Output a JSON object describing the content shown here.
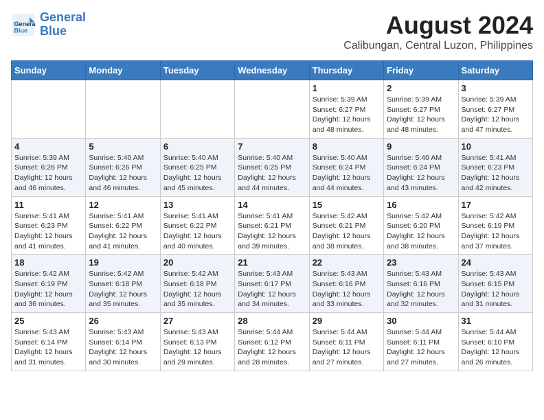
{
  "header": {
    "logo_line1": "General",
    "logo_line2": "Blue",
    "month_year": "August 2024",
    "location": "Calibungan, Central Luzon, Philippines"
  },
  "weekdays": [
    "Sunday",
    "Monday",
    "Tuesday",
    "Wednesday",
    "Thursday",
    "Friday",
    "Saturday"
  ],
  "weeks": [
    [
      {
        "day": "",
        "info": ""
      },
      {
        "day": "",
        "info": ""
      },
      {
        "day": "",
        "info": ""
      },
      {
        "day": "",
        "info": ""
      },
      {
        "day": "1",
        "info": "Sunrise: 5:39 AM\nSunset: 6:27 PM\nDaylight: 12 hours\nand 48 minutes."
      },
      {
        "day": "2",
        "info": "Sunrise: 5:39 AM\nSunset: 6:27 PM\nDaylight: 12 hours\nand 48 minutes."
      },
      {
        "day": "3",
        "info": "Sunrise: 5:39 AM\nSunset: 6:27 PM\nDaylight: 12 hours\nand 47 minutes."
      }
    ],
    [
      {
        "day": "4",
        "info": "Sunrise: 5:39 AM\nSunset: 6:26 PM\nDaylight: 12 hours\nand 46 minutes."
      },
      {
        "day": "5",
        "info": "Sunrise: 5:40 AM\nSunset: 6:26 PM\nDaylight: 12 hours\nand 46 minutes."
      },
      {
        "day": "6",
        "info": "Sunrise: 5:40 AM\nSunset: 6:25 PM\nDaylight: 12 hours\nand 45 minutes."
      },
      {
        "day": "7",
        "info": "Sunrise: 5:40 AM\nSunset: 6:25 PM\nDaylight: 12 hours\nand 44 minutes."
      },
      {
        "day": "8",
        "info": "Sunrise: 5:40 AM\nSunset: 6:24 PM\nDaylight: 12 hours\nand 44 minutes."
      },
      {
        "day": "9",
        "info": "Sunrise: 5:40 AM\nSunset: 6:24 PM\nDaylight: 12 hours\nand 43 minutes."
      },
      {
        "day": "10",
        "info": "Sunrise: 5:41 AM\nSunset: 6:23 PM\nDaylight: 12 hours\nand 42 minutes."
      }
    ],
    [
      {
        "day": "11",
        "info": "Sunrise: 5:41 AM\nSunset: 6:23 PM\nDaylight: 12 hours\nand 41 minutes."
      },
      {
        "day": "12",
        "info": "Sunrise: 5:41 AM\nSunset: 6:22 PM\nDaylight: 12 hours\nand 41 minutes."
      },
      {
        "day": "13",
        "info": "Sunrise: 5:41 AM\nSunset: 6:22 PM\nDaylight: 12 hours\nand 40 minutes."
      },
      {
        "day": "14",
        "info": "Sunrise: 5:41 AM\nSunset: 6:21 PM\nDaylight: 12 hours\nand 39 minutes."
      },
      {
        "day": "15",
        "info": "Sunrise: 5:42 AM\nSunset: 6:21 PM\nDaylight: 12 hours\nand 38 minutes."
      },
      {
        "day": "16",
        "info": "Sunrise: 5:42 AM\nSunset: 6:20 PM\nDaylight: 12 hours\nand 38 minutes."
      },
      {
        "day": "17",
        "info": "Sunrise: 5:42 AM\nSunset: 6:19 PM\nDaylight: 12 hours\nand 37 minutes."
      }
    ],
    [
      {
        "day": "18",
        "info": "Sunrise: 5:42 AM\nSunset: 6:19 PM\nDaylight: 12 hours\nand 36 minutes."
      },
      {
        "day": "19",
        "info": "Sunrise: 5:42 AM\nSunset: 6:18 PM\nDaylight: 12 hours\nand 35 minutes."
      },
      {
        "day": "20",
        "info": "Sunrise: 5:42 AM\nSunset: 6:18 PM\nDaylight: 12 hours\nand 35 minutes."
      },
      {
        "day": "21",
        "info": "Sunrise: 5:43 AM\nSunset: 6:17 PM\nDaylight: 12 hours\nand 34 minutes."
      },
      {
        "day": "22",
        "info": "Sunrise: 5:43 AM\nSunset: 6:16 PM\nDaylight: 12 hours\nand 33 minutes."
      },
      {
        "day": "23",
        "info": "Sunrise: 5:43 AM\nSunset: 6:16 PM\nDaylight: 12 hours\nand 32 minutes."
      },
      {
        "day": "24",
        "info": "Sunrise: 5:43 AM\nSunset: 6:15 PM\nDaylight: 12 hours\nand 31 minutes."
      }
    ],
    [
      {
        "day": "25",
        "info": "Sunrise: 5:43 AM\nSunset: 6:14 PM\nDaylight: 12 hours\nand 31 minutes."
      },
      {
        "day": "26",
        "info": "Sunrise: 5:43 AM\nSunset: 6:14 PM\nDaylight: 12 hours\nand 30 minutes."
      },
      {
        "day": "27",
        "info": "Sunrise: 5:43 AM\nSunset: 6:13 PM\nDaylight: 12 hours\nand 29 minutes."
      },
      {
        "day": "28",
        "info": "Sunrise: 5:44 AM\nSunset: 6:12 PM\nDaylight: 12 hours\nand 28 minutes."
      },
      {
        "day": "29",
        "info": "Sunrise: 5:44 AM\nSunset: 6:11 PM\nDaylight: 12 hours\nand 27 minutes."
      },
      {
        "day": "30",
        "info": "Sunrise: 5:44 AM\nSunset: 6:11 PM\nDaylight: 12 hours\nand 27 minutes."
      },
      {
        "day": "31",
        "info": "Sunrise: 5:44 AM\nSunset: 6:10 PM\nDaylight: 12 hours\nand 26 minutes."
      }
    ]
  ]
}
